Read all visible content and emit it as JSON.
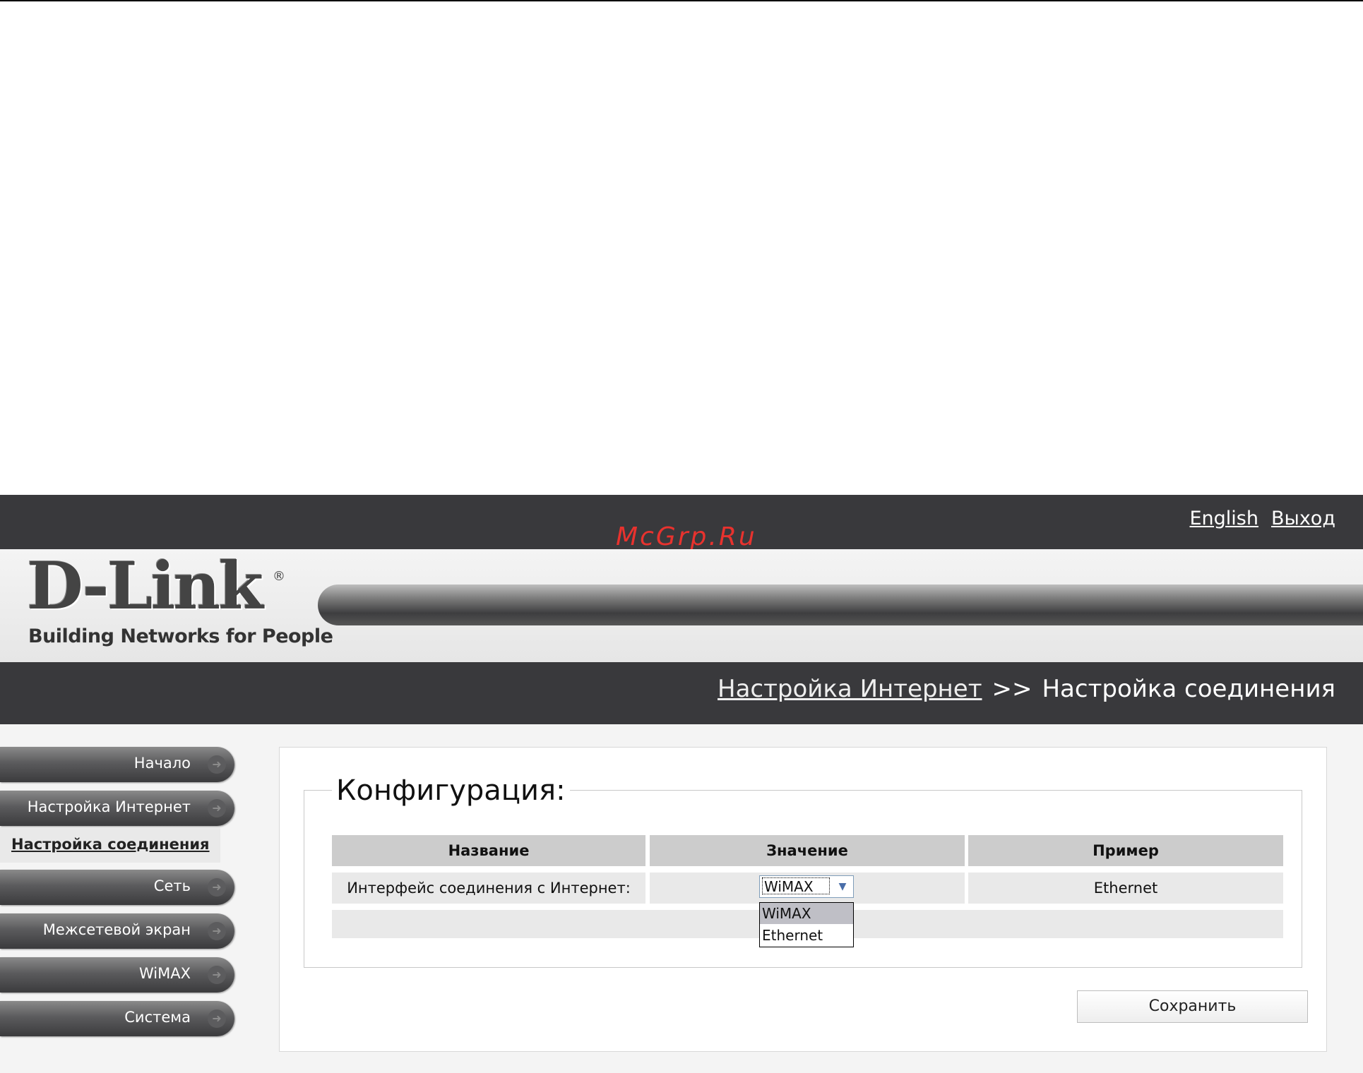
{
  "header": {
    "links": [
      "English",
      "Выход"
    ],
    "watermark": "McGrp.Ru"
  },
  "brand": {
    "logo": "D-Link",
    "registered": "®",
    "tagline": "Building Networks for People"
  },
  "breadcrumb": {
    "parent": "Настройка Интернет",
    "separator": ">>",
    "current": "Настройка соединения"
  },
  "sidebar": {
    "items": [
      {
        "label": "Начало"
      },
      {
        "label": "Настройка Интернет"
      },
      {
        "label": "Настройка соединения"
      },
      {
        "label": "Сеть"
      },
      {
        "label": "Межсетевой экран"
      },
      {
        "label": "WiMAX"
      },
      {
        "label": "Система"
      }
    ]
  },
  "config": {
    "title": "Конфигурация:",
    "columns": [
      "Название",
      "Значение",
      "Пример"
    ],
    "row": {
      "name": "Интерфейс соединения с Интернет:",
      "value": "WiMAX",
      "example": "Ethernet"
    },
    "options": [
      "WiMAX",
      "Ethernet"
    ],
    "save_label": "Сохранить"
  },
  "icons": {
    "nav_arrow": "arrow-right-icon",
    "select_arrow": "chevron-down-icon"
  }
}
